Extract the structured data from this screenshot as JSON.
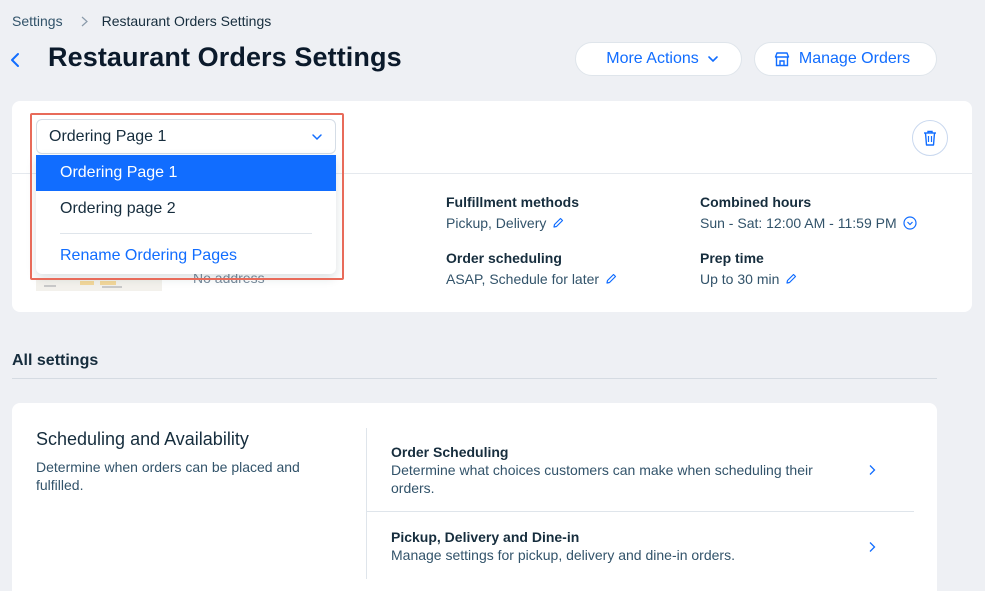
{
  "breadcrumb": {
    "root": "Settings",
    "current": "Restaurant Orders Settings"
  },
  "header": {
    "title": "Restaurant Orders Settings",
    "more_actions_label": "More Actions",
    "manage_orders_label": "Manage Orders"
  },
  "ordering_page_selector": {
    "selected_value": "Ordering Page 1",
    "options": [
      "Ordering Page 1",
      "Ordering page 2"
    ],
    "rename_link": "Rename Ordering Pages"
  },
  "location": {
    "address": "No address"
  },
  "details": {
    "fulfillment_label": "Fulfillment methods",
    "fulfillment_value": "Pickup, Delivery",
    "scheduling_label": "Order scheduling",
    "scheduling_value": "ASAP, Schedule for later",
    "hours_label": "Combined hours",
    "hours_value": "Sun - Sat: 12:00 AM - 11:59 PM",
    "prep_label": "Prep time",
    "prep_value": "Up to 30 min"
  },
  "all_settings": {
    "title": "All settings",
    "group": {
      "title": "Scheduling and Availability",
      "description": "Determine when orders can be placed and fulfilled."
    },
    "rows": [
      {
        "title": "Order Scheduling",
        "description": "Determine what choices customers can make when scheduling their orders."
      },
      {
        "title": "Pickup, Delivery and Dine-in",
        "description": "Manage settings for pickup, delivery and dine-in orders."
      }
    ]
  },
  "colors": {
    "accent": "#116dff",
    "highlight_border": "#e86b5a",
    "background": "#eef0f4"
  },
  "icons": [
    "chevron-right-icon",
    "back-arrow-icon",
    "chevron-down-icon",
    "store-icon",
    "trash-icon",
    "pencil-icon",
    "chevron-circle-down-icon"
  ]
}
